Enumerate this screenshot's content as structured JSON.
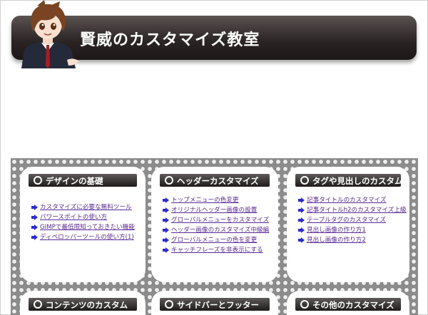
{
  "site": {
    "title": "賢威のカスタマイズ教室"
  },
  "cards": [
    {
      "title": "デザインの基礎",
      "links": [
        "カスタマイズに必要な無料ツール",
        "パワースポイトの使い方",
        "GIMPで最低限知っておきたい機能",
        "ディベロッパーツールの使い方(1)"
      ]
    },
    {
      "title": "ヘッダーカスタマイズ",
      "links": [
        "トップメニューの色変更",
        "オリジナルヘッダー画像の設置",
        "グローバルメニューをカスタマイズ",
        "ヘッダー画像のカスタマイズ中級編",
        "グローバルメニューの色を変更",
        "キャッチフレーズを非表示にする"
      ]
    },
    {
      "title": "タグや見出しのカスタム",
      "links": [
        "記事タイトルのカスタマイズ",
        "記事タイトルh2のカスタマイズ上級",
        "テーブルタグのカスタマイズ",
        "見出し画像の作り方1",
        "見出し画像の作り方2"
      ]
    },
    {
      "title": "コンテンツのカスタム",
      "links": []
    },
    {
      "title": "サイドバーとフッター",
      "links": []
    },
    {
      "title": "その他のカスタマイズ",
      "links": []
    }
  ],
  "colors": {
    "header_bg": "#2a2323",
    "link": "#5b2a9a",
    "bullet": "#2d2ad6"
  },
  "icons": {
    "bullet": "arrow-right-icon",
    "heading": "circle-icon",
    "mascot": "mascot-illustration"
  }
}
